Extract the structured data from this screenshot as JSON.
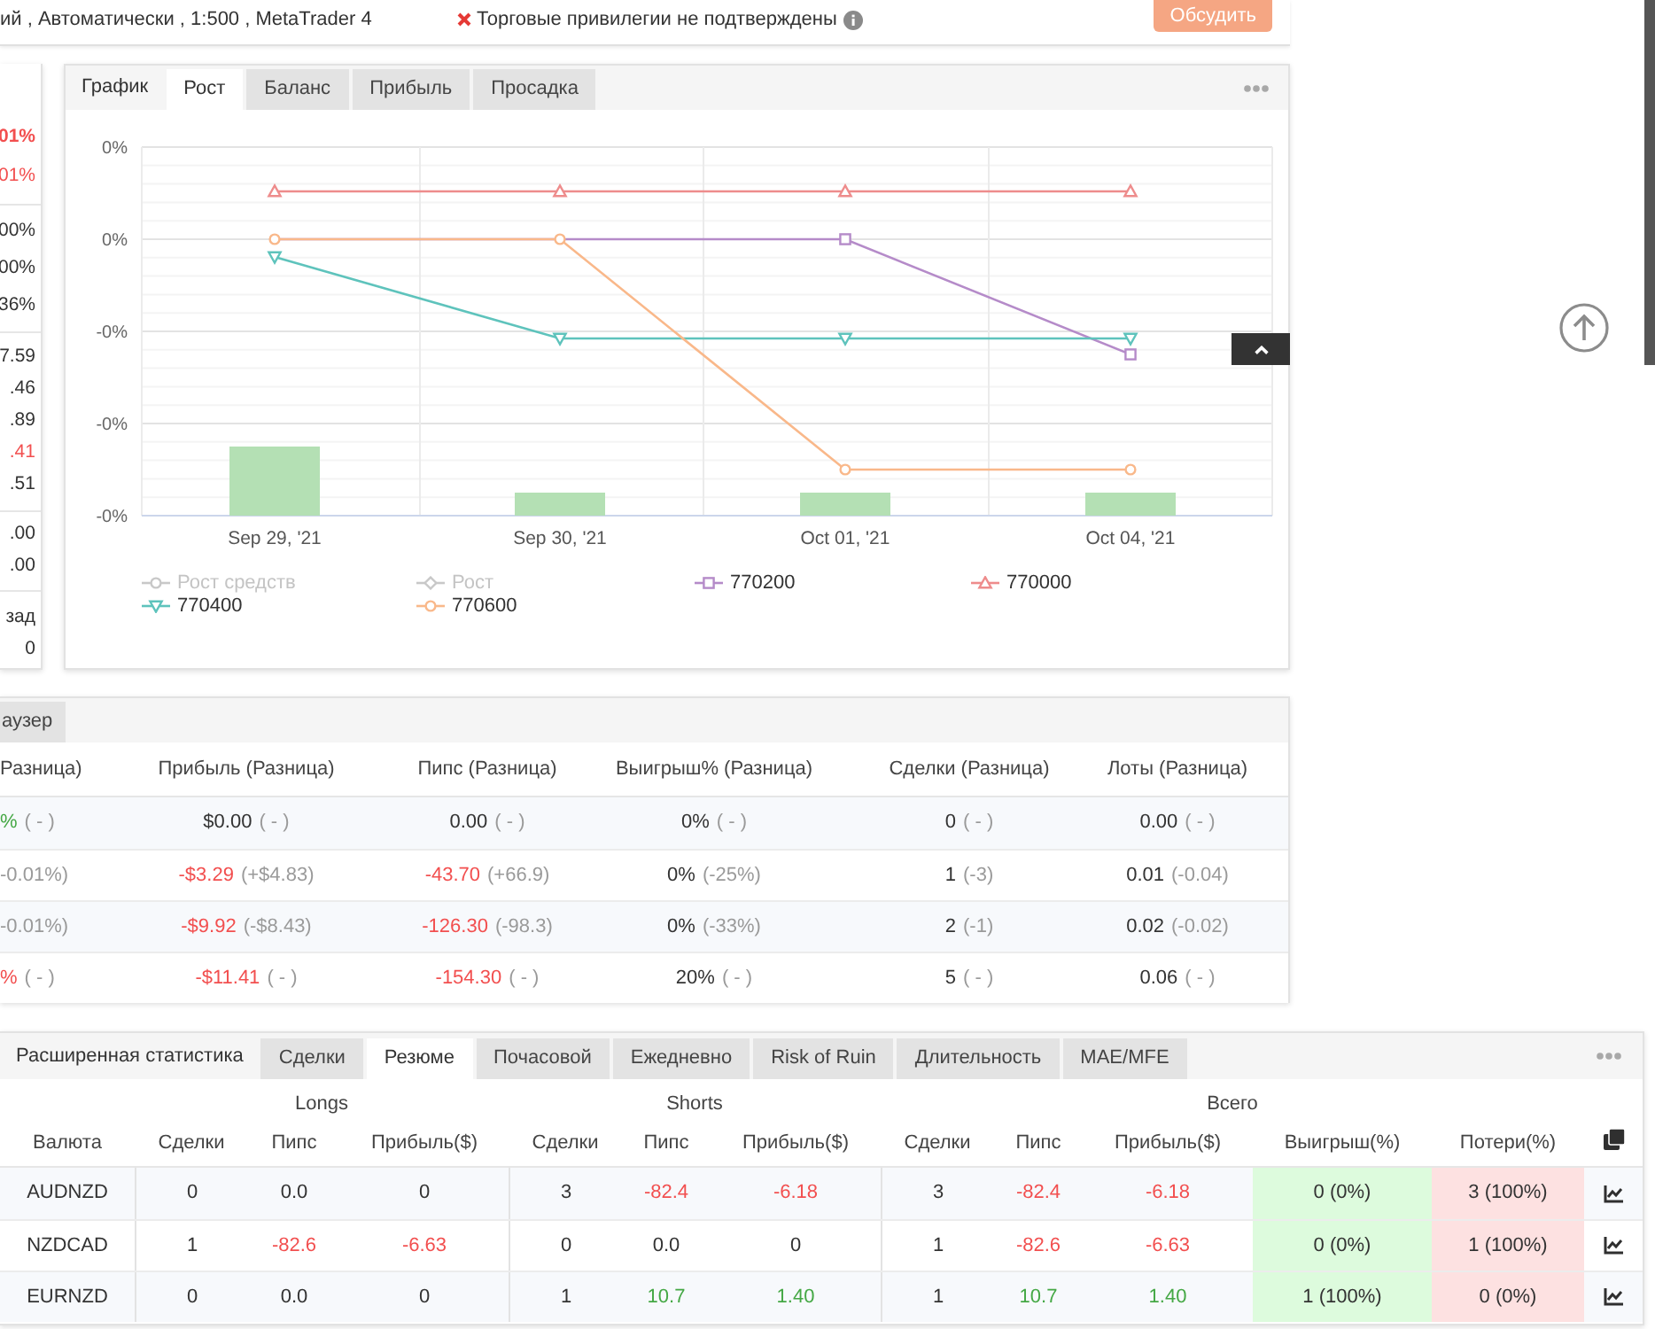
{
  "header": {
    "account_line": "ий , Автоматически , 1:500 , MetaTrader 4",
    "privileges": {
      "verified": false,
      "text": "Торговые привилегии не подтверждены"
    },
    "discuss_button": "Обсудить"
  },
  "side_stats": {
    "groups": [
      [
        {
          "value": "01%",
          "color": "#f24f4f",
          "strong": true
        },
        {
          "value": "01%",
          "color": "#f24f4f",
          "strong": false
        }
      ],
      [
        {
          "value": "00%",
          "color": "#333333",
          "strong": false
        },
        {
          "value": "00%",
          "color": "#333333",
          "strong": false
        },
        {
          "value": "36%",
          "color": "#333333",
          "strong": false
        }
      ],
      [
        {
          "value": "7.59",
          "color": "#333333",
          "strong": false
        },
        {
          "value": ".46",
          "color": "#333333",
          "strong": false
        },
        {
          "value": ".89",
          "color": "#333333",
          "strong": false
        },
        {
          "value": ".41",
          "color": "#f24f4f",
          "strong": false
        },
        {
          "value": ".51",
          "color": "#333333",
          "strong": false
        }
      ],
      [
        {
          "value": ".00",
          "color": "#333333",
          "strong": false
        },
        {
          "value": ".00",
          "color": "#333333",
          "strong": false
        }
      ],
      [
        {
          "value": "зад",
          "color": "#333333",
          "strong": false
        },
        {
          "value": "0",
          "color": "#333333",
          "strong": false
        }
      ]
    ]
  },
  "chart_panel": {
    "title": "График",
    "tabs": [
      {
        "label": "Рост",
        "selected": true
      },
      {
        "label": "Баланс",
        "selected": false
      },
      {
        "label": "Прибыль",
        "selected": false
      },
      {
        "label": "Просадка",
        "selected": false
      }
    ],
    "chart": {
      "y_labels": [
        "0%",
        "0%",
        "-0%",
        "-0%",
        "-0%"
      ],
      "x_labels": [
        "Sep 29, '21",
        "Sep 30, '21",
        "Oct 01, '21",
        "Oct 04, '21"
      ],
      "legend": [
        {
          "label": "Рост средств",
          "color": "#c8c8c8",
          "kind": "circle",
          "visible": false
        },
        {
          "label": "Рост",
          "color": "#c8c8c8",
          "kind": "diamond",
          "visible": false
        },
        {
          "label": "770200",
          "color": "#b58bc9",
          "kind": "square",
          "visible": true
        },
        {
          "label": "770000",
          "color": "#ee8c8c",
          "kind": "triangle",
          "visible": true
        },
        {
          "label": "770400",
          "color": "#5ec3bc",
          "kind": "triangle-down",
          "visible": true
        },
        {
          "label": "770600",
          "color": "#f9b88a",
          "kind": "circle",
          "visible": true
        }
      ]
    }
  },
  "comparison": {
    "tabs": [
      {
        "label": "аузер",
        "selected": false
      }
    ],
    "columns": [
      "Разница)",
      "Прибыль (Разница)",
      "Пипс (Разница)",
      "Выигрыш% (Разница)",
      "Сделки (Разница)",
      "Лоты (Разница)"
    ],
    "rows": [
      [
        {
          "value": "%",
          "color": "#45a845",
          "diff": "( - )"
        },
        {
          "value": "$0.00",
          "color": "#333333",
          "diff": "( - )"
        },
        {
          "value": "0.00",
          "color": "#333333",
          "diff": "( - )"
        },
        {
          "value": "0%",
          "color": "#333333",
          "diff": "( - )"
        },
        {
          "value": "0",
          "color": "#333333",
          "diff": "( - )"
        },
        {
          "value": "0.00",
          "color": "#333333",
          "diff": "( - )"
        }
      ],
      [
        {
          "diff": "-0.01%)"
        },
        {
          "value": "-$3.29",
          "color": "#f24f4f",
          "diff": "(+$4.83)"
        },
        {
          "value": "-43.70",
          "color": "#f24f4f",
          "diff": "(+66.9)"
        },
        {
          "value": "0%",
          "color": "#333333",
          "diff": "(-25%)"
        },
        {
          "value": "1",
          "color": "#333333",
          "diff": "(-3)"
        },
        {
          "value": "0.01",
          "color": "#333333",
          "diff": "(-0.04)"
        }
      ],
      [
        {
          "diff": "-0.01%)"
        },
        {
          "value": "-$9.92",
          "color": "#f24f4f",
          "diff": "(-$8.43)"
        },
        {
          "value": "-126.30",
          "color": "#f24f4f",
          "diff": "(-98.3)"
        },
        {
          "value": "0%",
          "color": "#333333",
          "diff": "(-33%)"
        },
        {
          "value": "2",
          "color": "#333333",
          "diff": "(-1)"
        },
        {
          "value": "0.02",
          "color": "#333333",
          "diff": "(-0.02)"
        }
      ],
      [
        {
          "value": "%",
          "color": "#f24f4f",
          "diff": "( - )"
        },
        {
          "value": "-$11.41",
          "color": "#f24f4f",
          "diff": "( - )"
        },
        {
          "value": "-154.30",
          "color": "#f24f4f",
          "diff": "( - )"
        },
        {
          "value": "20%",
          "color": "#333333",
          "diff": "( - )"
        },
        {
          "value": "5",
          "color": "#333333",
          "diff": "( - )"
        },
        {
          "value": "0.06",
          "color": "#333333",
          "diff": "( - )"
        }
      ]
    ]
  },
  "detailed_stats": {
    "title": "Расширенная статистика",
    "tabs": [
      {
        "label": "Сделки",
        "selected": false
      },
      {
        "label": "Резюме",
        "selected": true
      },
      {
        "label": "Почасовой",
        "selected": false
      },
      {
        "label": "Ежедневно",
        "selected": false
      },
      {
        "label": "Risk of Ruin",
        "selected": false
      },
      {
        "label": "Длительность",
        "selected": false
      },
      {
        "label": "MAE/MFE",
        "selected": false
      }
    ],
    "table": {
      "first_column": "Валюта",
      "groups": [
        {
          "label": "Longs",
          "columns": [
            {
              "label": "Сделки",
              "kind": "number"
            },
            {
              "label": "Пипс",
              "kind": "number"
            },
            {
              "label": "Прибыль($)",
              "kind": "number"
            }
          ]
        },
        {
          "label": "Shorts",
          "columns": [
            {
              "label": "Сделки",
              "kind": "number"
            },
            {
              "label": "Пипс",
              "kind": "number"
            },
            {
              "label": "Прибыль($)",
              "kind": "number"
            }
          ]
        },
        {
          "label": "Всего",
          "columns": [
            {
              "label": "Сделки",
              "kind": "number"
            },
            {
              "label": "Пипс",
              "kind": "number"
            },
            {
              "label": "Прибыль($)",
              "kind": "number"
            },
            {
              "label": "Выигрыш(%)",
              "kind": "win"
            },
            {
              "label": "Потери(%)",
              "kind": "loss"
            }
          ]
        }
      ],
      "rows": [
        {
          "currency": "AUDNZD",
          "cells": [
            {
              "value": "0",
              "color": "#333333"
            },
            {
              "value": "0.0",
              "color": "#333333"
            },
            {
              "value": "0",
              "color": "#333333"
            },
            {
              "value": "3",
              "color": "#333333"
            },
            {
              "value": "-82.4",
              "color": "#f24f4f"
            },
            {
              "value": "-6.18",
              "color": "#f24f4f"
            },
            {
              "value": "3",
              "color": "#333333"
            },
            {
              "value": "-82.4",
              "color": "#f24f4f"
            },
            {
              "value": "-6.18",
              "color": "#f24f4f"
            },
            {
              "value": "0 (0%)",
              "color": "#333333"
            },
            {
              "value": "3 (100%)",
              "color": "#333333"
            }
          ]
        },
        {
          "currency": "NZDCAD",
          "cells": [
            {
              "value": "1",
              "color": "#333333"
            },
            {
              "value": "-82.6",
              "color": "#f24f4f"
            },
            {
              "value": "-6.63",
              "color": "#f24f4f"
            },
            {
              "value": "0",
              "color": "#333333"
            },
            {
              "value": "0.0",
              "color": "#333333"
            },
            {
              "value": "0",
              "color": "#333333"
            },
            {
              "value": "1",
              "color": "#333333"
            },
            {
              "value": "-82.6",
              "color": "#f24f4f"
            },
            {
              "value": "-6.63",
              "color": "#f24f4f"
            },
            {
              "value": "0 (0%)",
              "color": "#333333"
            },
            {
              "value": "1 (100%)",
              "color": "#333333"
            }
          ]
        },
        {
          "currency": "EURNZD",
          "cells": [
            {
              "value": "0",
              "color": "#333333"
            },
            {
              "value": "0.0",
              "color": "#333333"
            },
            {
              "value": "0",
              "color": "#333333"
            },
            {
              "value": "1",
              "color": "#333333"
            },
            {
              "value": "10.7",
              "color": "#45a845"
            },
            {
              "value": "1.40",
              "color": "#45a845"
            },
            {
              "value": "1",
              "color": "#333333"
            },
            {
              "value": "10.7",
              "color": "#45a845"
            },
            {
              "value": "1.40",
              "color": "#45a845"
            },
            {
              "value": "1 (100%)",
              "color": "#333333"
            },
            {
              "value": "0 (0%)",
              "color": "#333333"
            }
          ]
        }
      ]
    }
  }
}
